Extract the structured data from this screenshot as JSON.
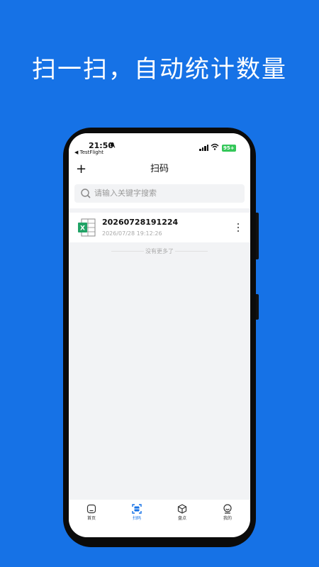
{
  "headline": "扫一扫，自动统计数量",
  "status_bar": {
    "time": "21:50",
    "back_app": "◀ TestFlight",
    "battery": "95+"
  },
  "navbar": {
    "add_label": "+",
    "title": "扫码"
  },
  "search": {
    "placeholder": "请输入关键字搜索"
  },
  "list": {
    "items": [
      {
        "name": "20260728191224",
        "date": "2026/07/28 19:12:26",
        "icon": "excel-file-icon"
      }
    ],
    "end_text": "没有更多了"
  },
  "tabs": [
    {
      "label": "首页",
      "icon": "home-icon",
      "active": false
    },
    {
      "label": "扫码",
      "icon": "scan-icon",
      "active": true
    },
    {
      "label": "盘点",
      "icon": "box-icon",
      "active": false
    },
    {
      "label": "我的",
      "icon": "profile-icon",
      "active": false
    }
  ],
  "colors": {
    "brand": "#1672E6",
    "excel_green": "#21A366",
    "battery": "#34C759"
  }
}
